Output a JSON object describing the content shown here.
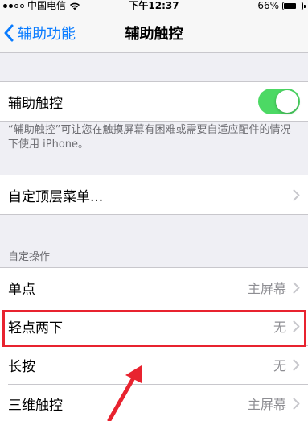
{
  "status_bar": {
    "carrier": "中国电信",
    "time": "下午12:37",
    "battery_percent": "66%",
    "battery_level": 0.66
  },
  "nav": {
    "back_label": "辅助功能",
    "title": "辅助触控"
  },
  "main_toggle": {
    "label": "辅助触控",
    "enabled": true,
    "footnote": "“辅助触控”可让您在触摸屏幕有困难或需要自适应配件的情况下使用 iPhone。"
  },
  "top_menu": {
    "label": "自定顶层菜单..."
  },
  "custom_actions": {
    "header": "自定操作",
    "items": [
      {
        "label": "单点",
        "value": "主屏幕"
      },
      {
        "label": "轻点两下",
        "value": "无"
      },
      {
        "label": "长按",
        "value": "无"
      },
      {
        "label": "三维触控",
        "value": "主屏幕"
      }
    ]
  },
  "colors": {
    "accent": "#0a7cff",
    "toggle_on": "#4cd964",
    "highlight": "#e8232f"
  }
}
